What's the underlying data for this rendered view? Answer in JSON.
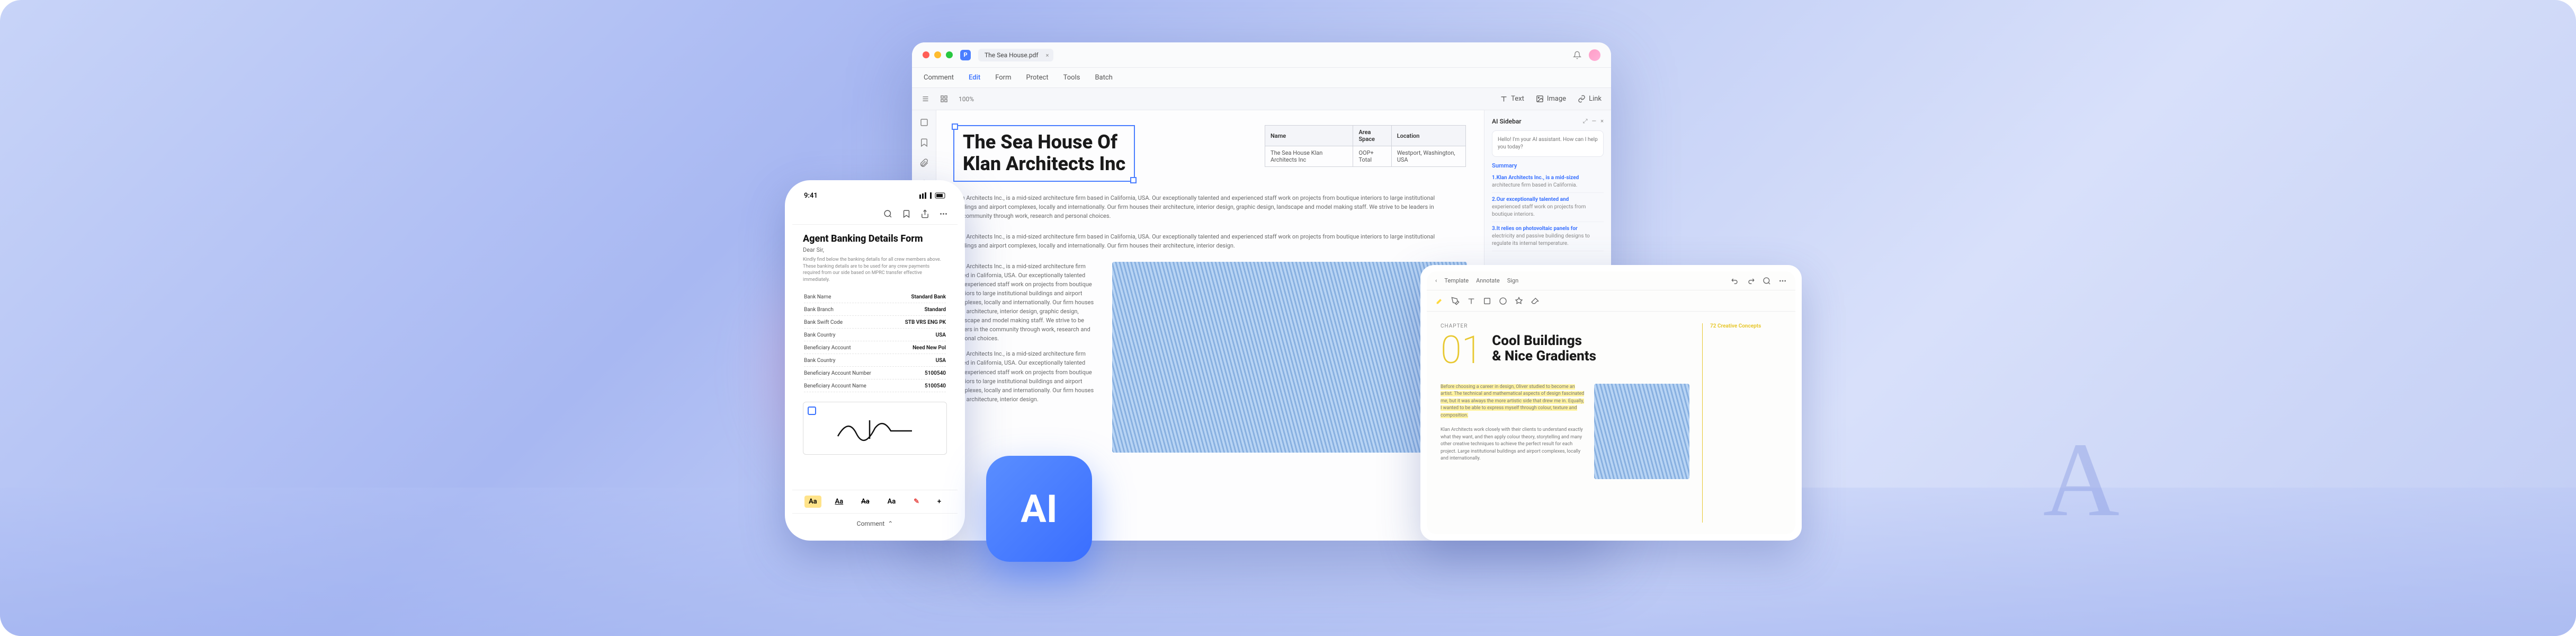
{
  "hero": {
    "ai_badge": "AI",
    "watermark": "A"
  },
  "desktop": {
    "file_name": "The Sea House.pdf",
    "app_letter": "P",
    "menu": {
      "comment": "Comment",
      "edit": "Edit",
      "form": "Form",
      "protect": "Protect",
      "tools": "Tools",
      "batch": "Batch"
    },
    "zoom": "100%",
    "tools": {
      "text": "Text",
      "image": "Image",
      "link": "Link"
    },
    "doc": {
      "title_l1": "The Sea House Of",
      "title_l2": "Klan Architects Inc",
      "table": {
        "h1": "Name",
        "h2": "Area Space",
        "h3": "Location",
        "r1c1": "The Sea House Klan Architects Inc",
        "r1c2": "OOP+ Total",
        "r1c3": "Westport, Washington, USA"
      },
      "p1": "Klan Architects Inc., is a mid-sized architecture firm based in California, USA. Our exceptionally talented and experienced staff work on projects from boutique interiors to large institutional buildings and airport complexes, locally and internationally. Our firm houses their architecture, interior design, graphic design, landscape and model making staff. We strive to be leaders in the community through work, research and personal choices.",
      "p2": "Klan Architects Inc., is a mid-sized architecture firm based in California, USA. Our exceptionally talented and experienced staff work on projects from boutique interiors to large institutional buildings and airport complexes, locally and internationally. Our firm houses their architecture, interior design.",
      "col": "Klan Architects Inc., is a mid-sized architecture firm based in California, USA. Our exceptionally talented and experienced staff work on projects from boutique interiors to large institutional buildings and airport complexes, locally and internationally. Our firm houses their architecture, interior design, graphic design, landscape and model making staff. We strive to be leaders in the community through work, research and personal choices.",
      "col2": "Klan Architects Inc., is a mid-sized architecture firm based in California, USA. Our exceptionally talented and experienced staff work on projects from boutique interiors to large institutional buildings and airport complexes, locally and internationally. Our firm houses their architecture, interior design."
    },
    "ai": {
      "title": "AI Sidebar",
      "greeting": "Hello! I'm your AI assistant. How can I help you today?",
      "section": "Summary",
      "items": [
        {
          "t": "1.Klan Architects Inc., is a mid-sized",
          "s": "architecture firm based in California."
        },
        {
          "t": "2.Our exceptionally talented and",
          "s": "experienced staff work on projects from boutique interiors."
        },
        {
          "t": "3.It relies on photovoltaic panels for",
          "s": "electricity and passive building designs to regulate its internal temperature."
        }
      ]
    }
  },
  "phone": {
    "time": "9:41",
    "title": "Agent Banking Details Form",
    "greeting": "Dear Sir,",
    "intro": "Kindly find below the banking details for all crew members above. These banking details are to be used for any crew payments required from our side based on MPRC transfer effective immediately.",
    "rows": [
      {
        "k": "Bank Name",
        "v": "Standard Bank"
      },
      {
        "k": "Bank Branch",
        "v": "Standard"
      },
      {
        "k": "Bank Swift Code",
        "v": "STB VRS ENG PK"
      },
      {
        "k": "Bank Country",
        "v": "USA"
      },
      {
        "k": "Beneficiary Account",
        "v": "Need New Pol"
      },
      {
        "k": "Bank Country",
        "v": "USA"
      },
      {
        "k": "Beneficiary Account Number",
        "v": "5100540"
      },
      {
        "k": "Beneficiary Account Name",
        "v": "5100540"
      }
    ],
    "fmt": {
      "aa1": "Aa",
      "aa2": "Aa",
      "aa3": "Aa",
      "aa4": "Aa",
      "pen": "✎",
      "plus": "+"
    },
    "comment": "Comment"
  },
  "tablet": {
    "tabs": {
      "t1": "Template",
      "t2": "Annotate",
      "t3": "Sign"
    },
    "kicker": "CHAPTER",
    "num": "01",
    "title_l1": "Cool Buildings",
    "title_l2": "& Nice Gradients",
    "side_title": "72 Creative Concepts",
    "para1": "Before choosing a career in design, Oliver studied to become an artist. The technical and mathematical aspects of design fascinated me, but it was always the more artistic side that drew me in. Equally, I wanted to be able to express myself through colour, texture and composition.",
    "para2": "Klan Architects work closely with their clients to understand exactly what they want, and then apply colour theory, storytelling and many other creative techniques to achieve the perfect result for each project. Large institutional buildings and airport complexes, locally and internationally."
  }
}
